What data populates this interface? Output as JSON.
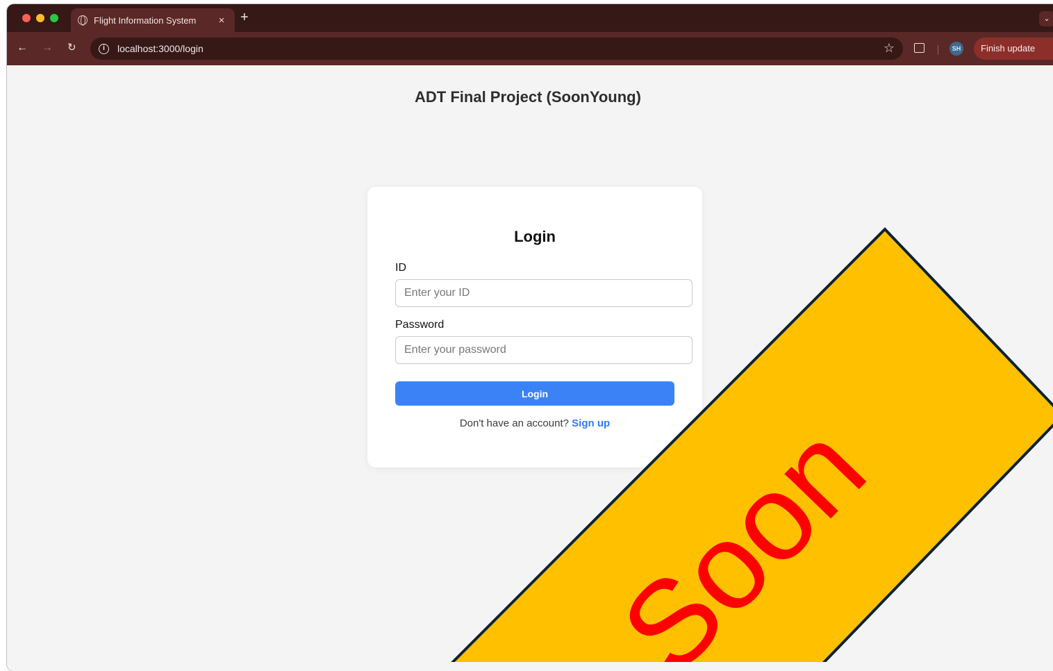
{
  "browser": {
    "tab_title": "Flight Information System",
    "tab_close": "×",
    "new_tab": "+",
    "tab_menu": "⌄",
    "url": "localhost:3000/login",
    "avatar_initials": "SH",
    "update_button": "Finish update",
    "menu_dots": "⋮",
    "icons": {
      "back": "arrow-left-icon",
      "forward": "arrow-right-icon",
      "reload": "reload-icon",
      "site_info": "info-icon",
      "bookmark": "star-icon",
      "extensions": "puzzle-icon"
    },
    "colors": {
      "tabstrip": "#361816",
      "toolbar": "#5a2826",
      "update_button": "#8c2f2a"
    }
  },
  "page": {
    "title": "ADT Final Project (SoonYoung)",
    "login_card": {
      "heading": "Login",
      "id_label": "ID",
      "id_value": "",
      "id_placeholder": "Enter your ID",
      "password_label": "Password",
      "password_value": "",
      "password_placeholder": "Enter your password",
      "submit_label": "Login",
      "signup_prompt": "Don't have an account?",
      "signup_link": "Sign up"
    },
    "colors": {
      "primary": "#3b82f6",
      "link": "#2f7bf0",
      "background": "#f4f4f4"
    }
  },
  "overlay_banner": {
    "text": "Soon",
    "fill": "#ffc000",
    "stroke": "#0b2233",
    "text_color": "#ff0000"
  }
}
